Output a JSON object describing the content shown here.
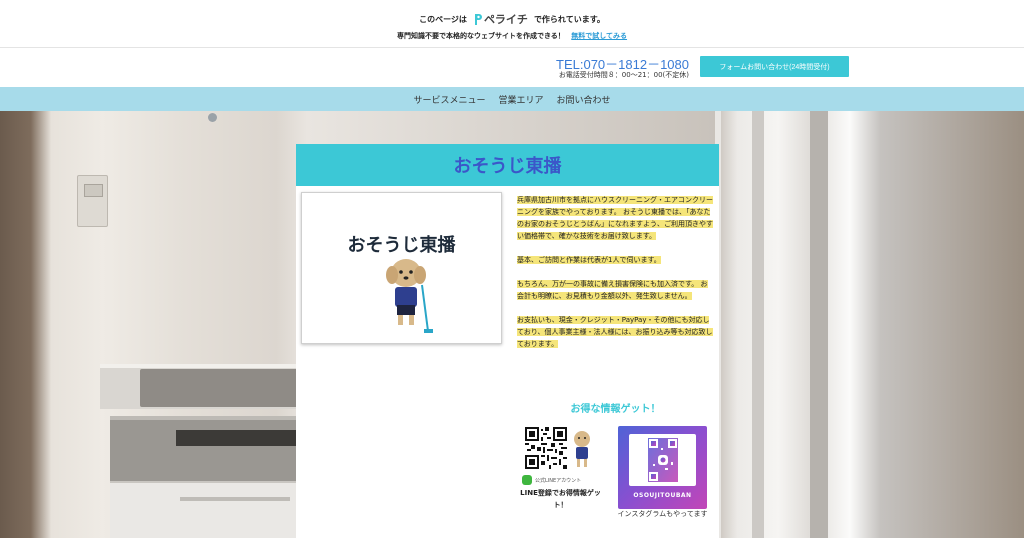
{
  "promo": {
    "prefix": "このページは",
    "brand": "ペライチ",
    "suffix": "で作られています。",
    "line2": "専門知識不要で本格的なウェブサイトを作成できる！",
    "trial_link": "無料で試してみる"
  },
  "header": {
    "tel": "TEL:070－1812－1080",
    "hours": "お電話受付時間８：00〜21：00(不定休)",
    "contact_button": "フォームお問い合わせ(24時間受付)"
  },
  "nav": {
    "items": [
      "サービスメニュー",
      "営業エリア",
      "お問い合わせ"
    ]
  },
  "main": {
    "title": "おそうじ東播",
    "logo_text": "おそうじ東播",
    "paragraphs": [
      "兵庫県加古川市を拠点にハウスクリーニング・エアコンクリーニングを家族でやっております。 おそうじ東播では、「あなたのお家のおそうじとうばん」になれますよう、ご利用頂きやすい価格帯で、確かな技術をお届け致します。",
      "基本、ご訪問と作業は代表が1人で伺います。",
      "もちろん、万が一の事故に備え損害保険にも加入済です。 お会計も明瞭に、お見積もり金額以外、発生致しません。",
      "お支払いも、現金・クレジット・PayPay・その他にも対応しており、個人事業主様・法人様には、お振り込み等も対応致しております。"
    ],
    "deal_heading": "お得な情報ゲット！",
    "line_account_label": "公式LINEアカウント",
    "line_caption": "LINE登録でお得情報ゲット！",
    "insta_label": "OSOUJITOUBAN",
    "insta_caption": "インスタグラムもやってます"
  },
  "colors": {
    "accent": "#3cc8d6",
    "title": "#3b57c9",
    "nav_bg": "#a7dbea",
    "highlight": "#f5e57a",
    "tel": "#3a7bd5"
  }
}
